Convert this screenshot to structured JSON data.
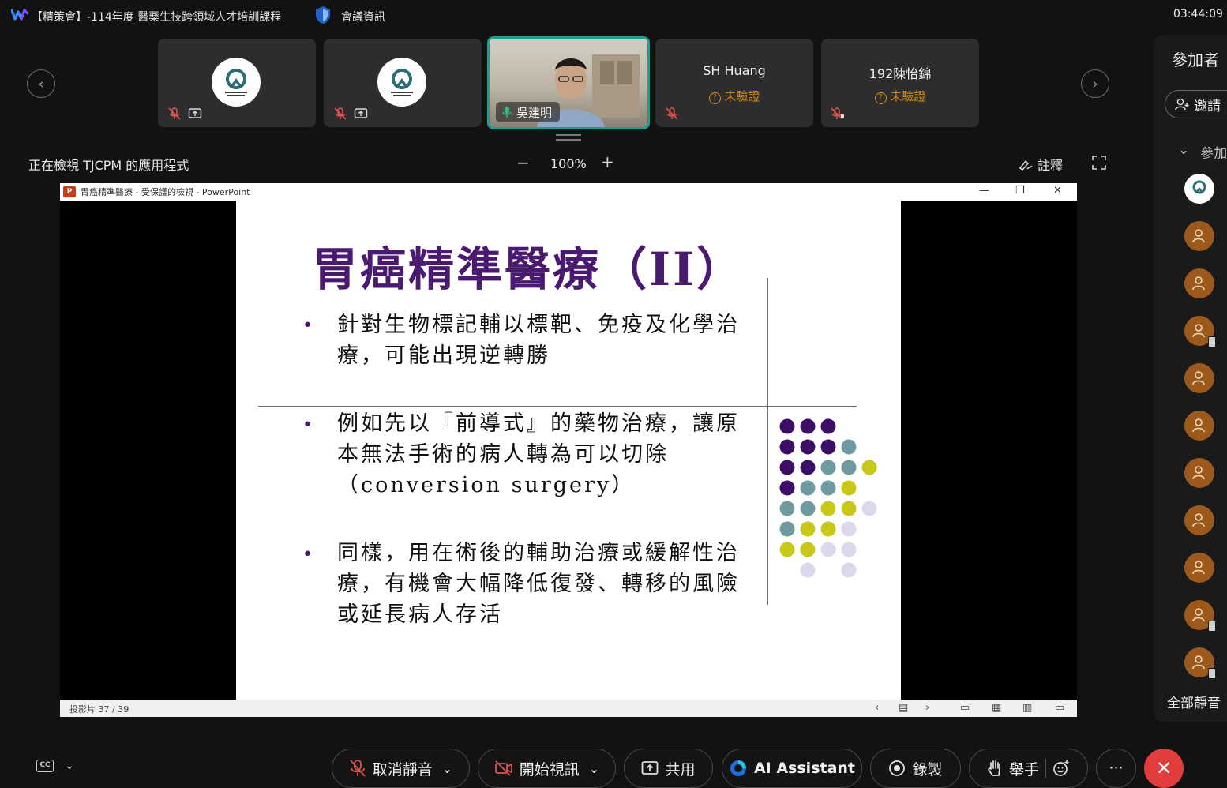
{
  "window": {
    "title": "【精策會】-114年度 醫藥生技跨領域人才培訓課程",
    "meeting_info": "會議資訊",
    "clock": "03:44:09"
  },
  "thumbnails": [
    {
      "type": "logo"
    },
    {
      "type": "logo"
    },
    {
      "type": "video",
      "name": "吳建明"
    },
    {
      "type": "name",
      "name": "SH Huang",
      "status": "未驗證"
    },
    {
      "type": "name",
      "name": "192陳怡錦",
      "status": "未驗證"
    }
  ],
  "share_toolbar": {
    "viewing_label": "正在檢視 TJCPM 的應用程式",
    "zoom_minus": "−",
    "zoom_level": "100%",
    "zoom_plus": "+",
    "annotate": "註釋"
  },
  "ppt": {
    "window_title": "胃癌精準醫療 - 受保護的檢視 - PowerPoint",
    "slide_title": "胃癌精準醫療（II）",
    "bullets": [
      "針對生物標記輔以標靶、免疫及化學治療，可能出現逆轉勝",
      "例如先以『前導式』的藥物治療，讓原本無法手術的病人轉為可以切除（conversion surgery）",
      "同樣，用在術後的輔助治療或緩解性治療，有機會大幅降低復發、轉移的風險或延長病人存活"
    ],
    "slide_counter": "投影片 37 / 39",
    "dot_colors": {
      "purple": "#3d0e66",
      "teal": "#6f9aa0",
      "olive": "#c8c81a",
      "lavender": "#dcd8ec"
    }
  },
  "participants": {
    "title": "參加者",
    "invite": "邀請",
    "section": "參加",
    "mute_all": "全部靜音",
    "avatar_color": "#9b5a1c"
  },
  "controls": {
    "unmute": "取消靜音",
    "start_video": "開始視訊",
    "share": "共用",
    "ai_assistant": "AI Assistant",
    "record": "錄製",
    "raise_hand": "舉手",
    "more": "···"
  },
  "colors": {
    "accent_teal": "#1f9e8f",
    "warning": "#d08a1c",
    "end_red": "#e23d3d",
    "muted_red": "#e0524f"
  }
}
